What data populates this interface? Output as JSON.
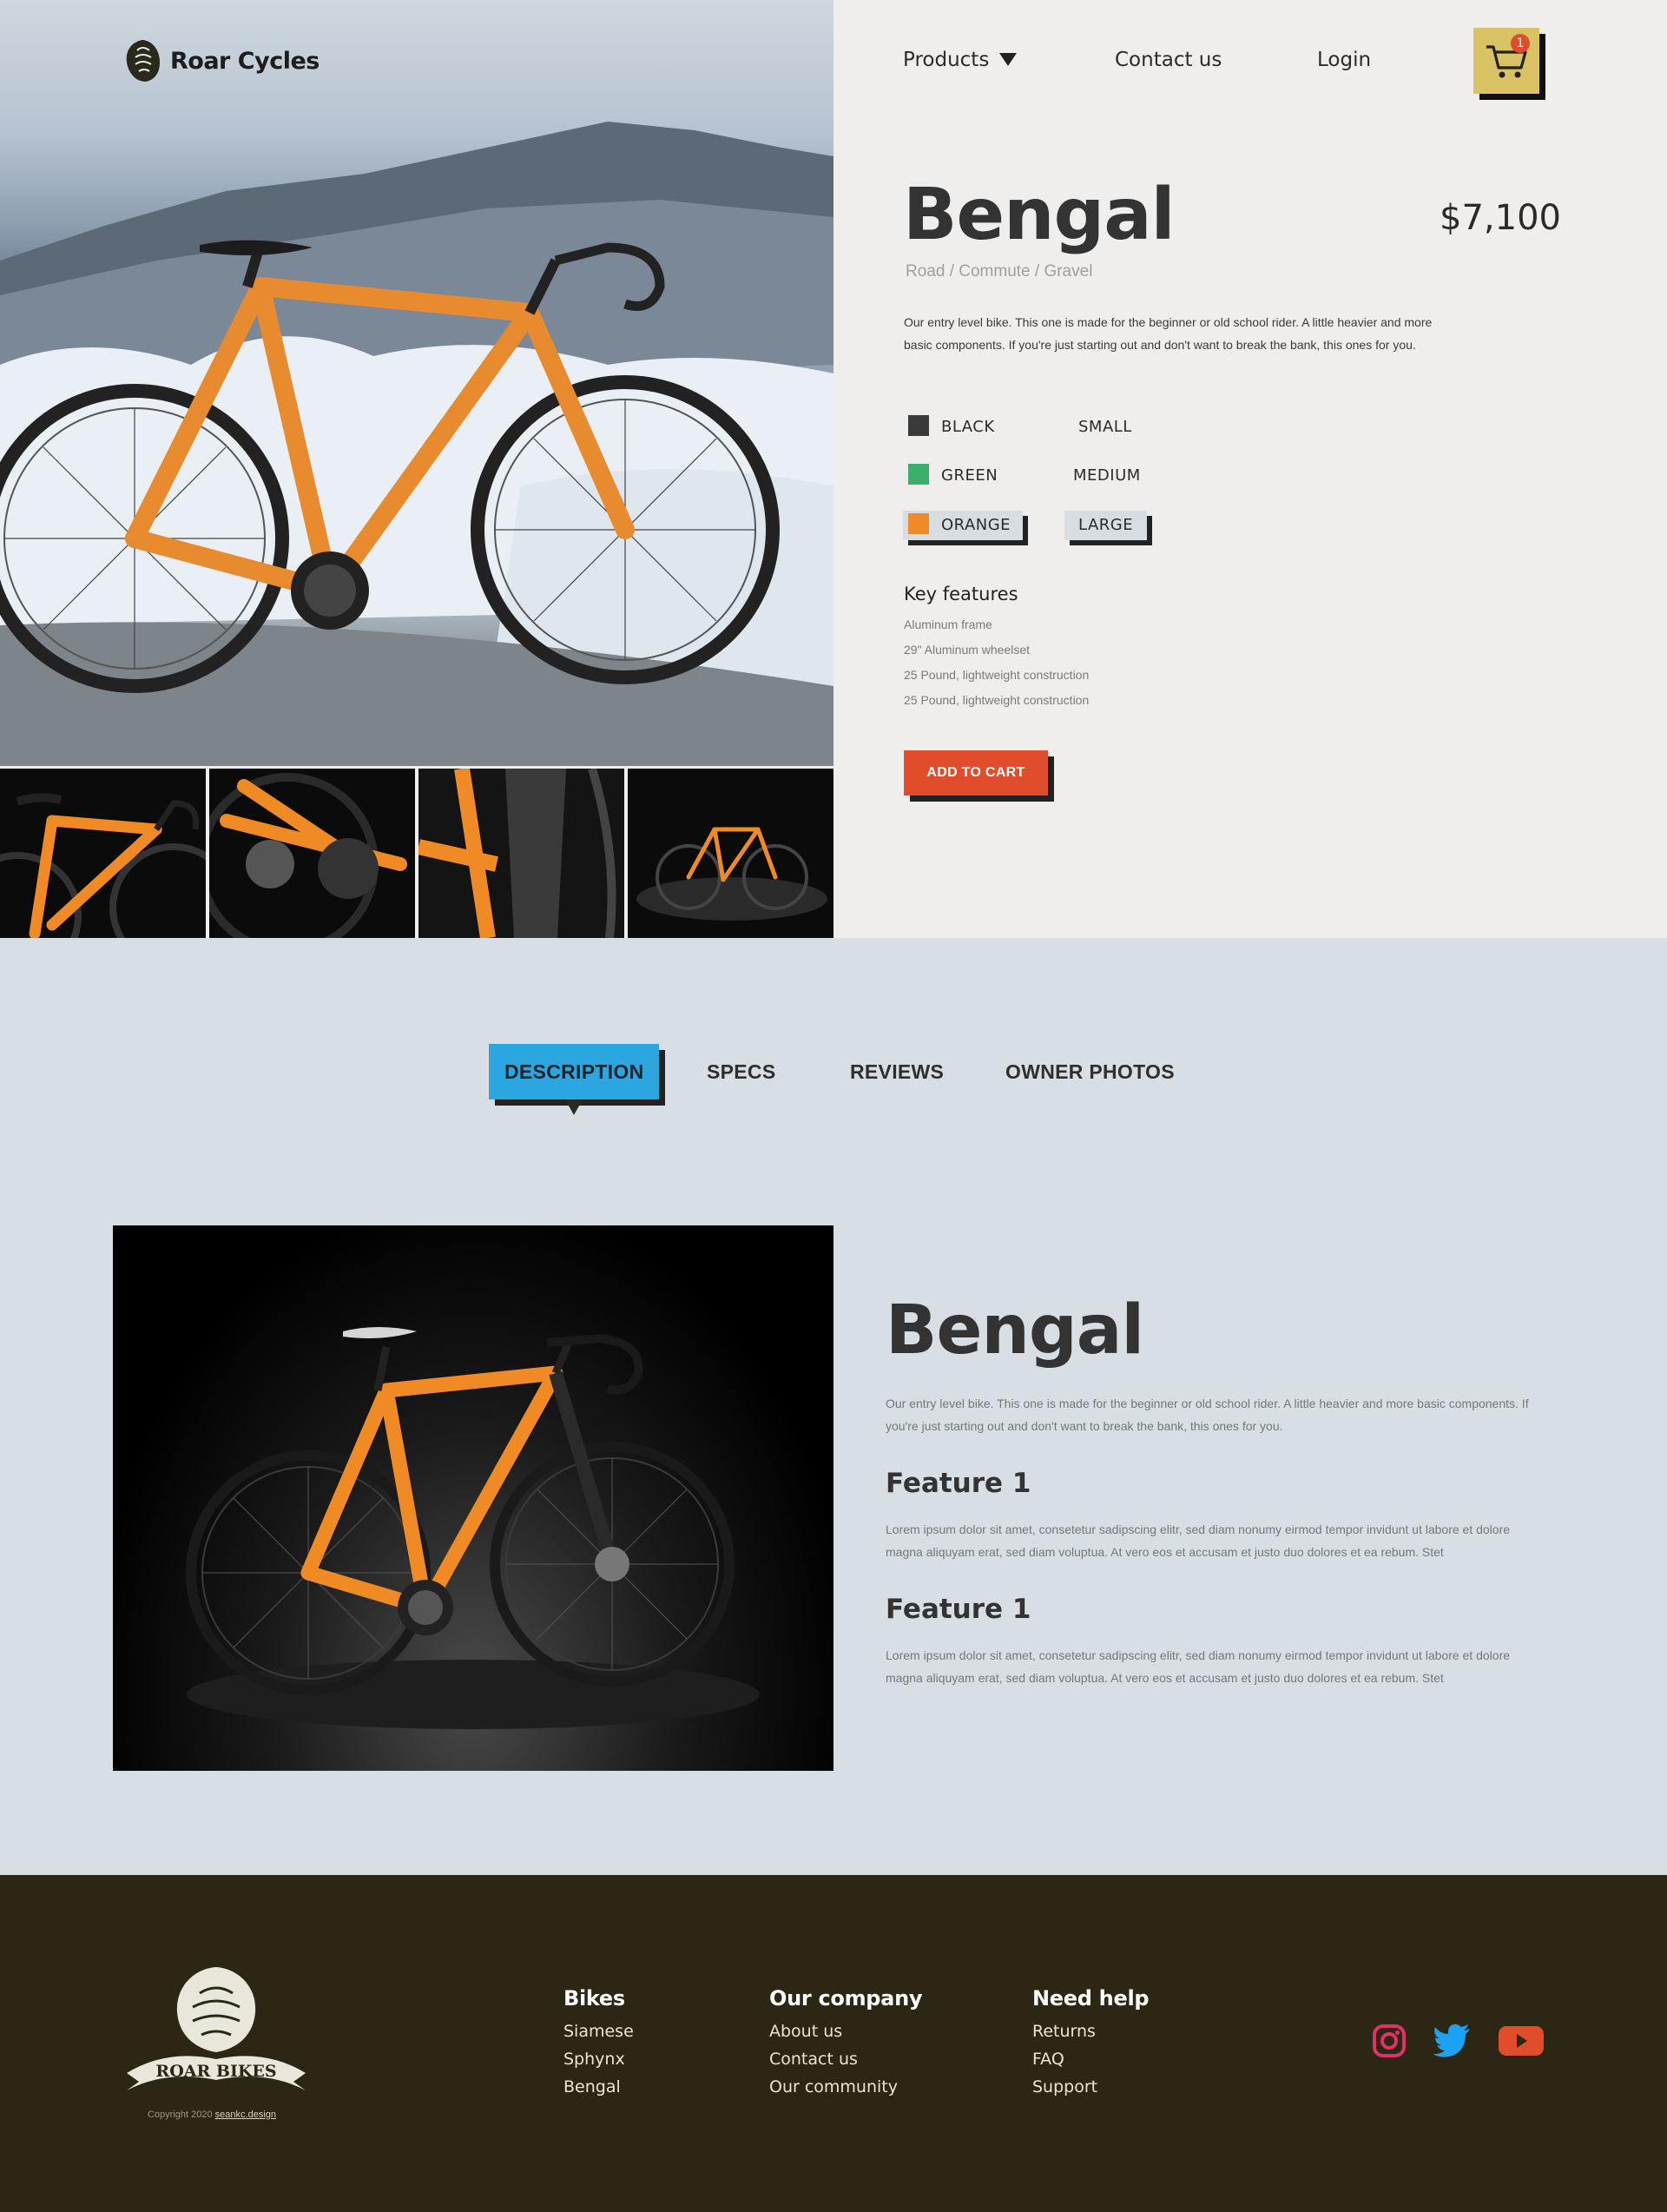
{
  "brand": {
    "name": "Roar Cycles"
  },
  "nav": {
    "products": "Products",
    "contact": "Contact us",
    "login": "Login",
    "cart_count": "1"
  },
  "product": {
    "name": "Bengal",
    "price": "$7,100",
    "categories": "Road / Commute / Gravel",
    "description": "Our entry level bike. This one is made for the beginner or old school rider. A little heavier and more basic components. If you're just starting out and don't want to break the bank, this ones for you.",
    "colors": [
      {
        "label": "BLACK",
        "swatch": "#3a3a3a"
      },
      {
        "label": "GREEN",
        "swatch": "#3dae6a"
      },
      {
        "label": "ORANGE",
        "swatch": "#f08a24",
        "selected": true
      }
    ],
    "sizes": [
      {
        "label": "SMALL"
      },
      {
        "label": "MEDIUM"
      },
      {
        "label": "LARGE",
        "selected": true
      }
    ],
    "key_features_title": "Key features",
    "key_features": [
      "Aluminum frame",
      "29\" Aluminum wheelset",
      "25 Pound, lightweight construction",
      "25 Pound, lightweight construction"
    ],
    "add_to_cart": "ADD TO CART"
  },
  "tabs": [
    {
      "label": "DESCRIPTION",
      "active": true
    },
    {
      "label": "SPECS"
    },
    {
      "label": "REVIEWS"
    },
    {
      "label": "OWNER PHOTOS"
    }
  ],
  "details": {
    "title": "Bengal",
    "intro": "Our entry level bike. This one is made for the beginner or old school rider. A little heavier and more basic components. If you're just starting out and don't want to break the bank, this ones for you.",
    "features": [
      {
        "title": "Feature 1",
        "text": "Lorem ipsum dolor sit amet, consetetur sadipscing elitr, sed diam nonumy eirmod tempor invidunt ut labore et dolore magna aliquyam erat, sed diam voluptua. At vero eos et accusam et justo duo dolores et ea rebum. Stet"
      },
      {
        "title": "Feature 1",
        "text": "Lorem ipsum dolor sit amet, consetetur sadipscing elitr, sed diam nonumy eirmod tempor invidunt ut labore et dolore magna aliquyam erat, sed diam voluptua. At vero eos et accusam et justo duo dolores et ea rebum. Stet"
      }
    ]
  },
  "footer": {
    "logo_text": "ROAR BIKES",
    "copyright_prefix": "Copyright 2020",
    "copyright_link": "seankc.design",
    "columns": [
      {
        "title": "Bikes",
        "links": [
          "Siamese",
          "Sphynx",
          "Bengal"
        ]
      },
      {
        "title": "Our company",
        "links": [
          "About us",
          "Contact us",
          "Our community"
        ]
      },
      {
        "title": "Need help",
        "links": [
          "Returns",
          "FAQ",
          "Support"
        ]
      }
    ],
    "social": [
      {
        "name": "instagram-icon",
        "color": "#e1306c"
      },
      {
        "name": "twitter-icon",
        "color": "#1da1f2"
      },
      {
        "name": "youtube-icon",
        "color": "#e04d2a"
      }
    ]
  },
  "colors": {
    "accent": "#e04d2a",
    "tab_active": "#2ba6df",
    "cart_bg": "#d9c264",
    "footer_bg": "#2c2714",
    "bike_orange": "#f08a24"
  }
}
